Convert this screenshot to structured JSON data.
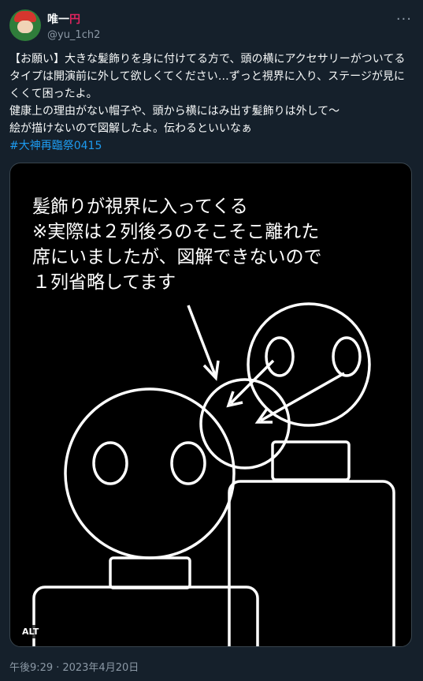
{
  "user": {
    "display_name": "唯一",
    "display_mark": "円",
    "handle": "@yu_1ch2"
  },
  "icons": {
    "more": "more-horizontal-icon"
  },
  "tweet": {
    "line1": "【お願い】大きな髪飾りを身に付けてる方で、頭の横にアクセサリーがついてるタイプは開演前に外して欲しくてください…ずっと視界に入り、ステージが見にくくて困ったよ。",
    "line2": "健康上の理由がない帽子や、頭から横にはみ出す髪飾りは外して〜",
    "line3": "絵が描けないので図解したよ。伝わるといいなぁ",
    "hashtag": "#大神再臨祭0415"
  },
  "media": {
    "caption_lines": [
      "髪飾りが視界に入ってくる",
      "※実際は２列後ろのそこそこ離れた",
      "席にいましたが、図解できないので",
      "１列省略してます"
    ],
    "alt_label": "ALT"
  },
  "meta": {
    "time": "午後9:29",
    "separator": "·",
    "date": "2023年4月20日"
  },
  "colors": {
    "background": "#15202b",
    "text": "#f7f9f9",
    "muted": "#8b98a5",
    "link": "#1d9bf0"
  }
}
